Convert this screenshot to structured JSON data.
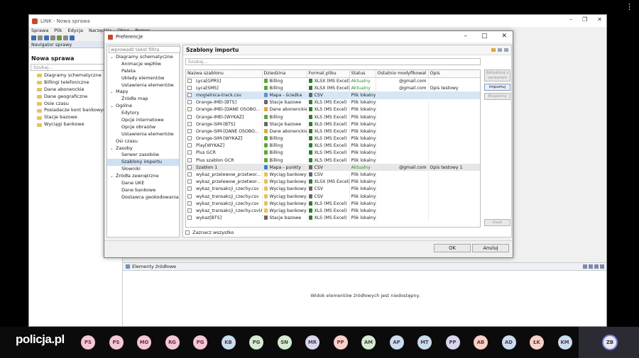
{
  "window": {
    "app_title": "LINK - Nowa sprawa",
    "menu": [
      "Sprawa",
      "Plik",
      "Edycja",
      "Narzędzia",
      "Okno",
      "Pomoc"
    ]
  },
  "navigator": {
    "tab": "Navigator sprawy",
    "title": "Nowa sprawa",
    "search_placeholder": "Szukaj...",
    "items": [
      "Diagramy schematyczne",
      "Billingi telefoniczne",
      "Dane abonenckie",
      "Dane geograficzne",
      "Osie czasu",
      "Posiadacze kont bankowych",
      "Stacje bazowe",
      "Wyciągi bankowe"
    ]
  },
  "bottom_panel": {
    "tab": "Elementy źródłowe",
    "message": "Widok elementów źródłowych jest niedostępny."
  },
  "dialog": {
    "title": "Preferencje",
    "filter_placeholder": "wprowadź tekst filtra",
    "tree": [
      {
        "label": "Diagramy schematyczne",
        "level": 0,
        "expander": "v"
      },
      {
        "label": "Animacje węzłów",
        "level": 1
      },
      {
        "label": "Paleta",
        "level": 1
      },
      {
        "label": "Układy elementów",
        "level": 1
      },
      {
        "label": "Ustawienia elementów",
        "level": 1
      },
      {
        "label": "Mapy",
        "level": 0,
        "expander": "v"
      },
      {
        "label": "Źródła map",
        "level": 1
      },
      {
        "label": "Ogólne",
        "level": 0,
        "expander": "v"
      },
      {
        "label": "Edytory",
        "level": 1
      },
      {
        "label": "Opcje internetowe",
        "level": 1
      },
      {
        "label": "Opcje obrazów",
        "level": 1
      },
      {
        "label": "Ustawienia elementów",
        "level": 1
      },
      {
        "label": "Osi czasu",
        "level": 0
      },
      {
        "label": "Zasoby",
        "level": 0,
        "expander": "v"
      },
      {
        "label": "Serwer zasobów",
        "level": 1
      },
      {
        "label": "Szablony importu",
        "level": 1,
        "selected": true
      },
      {
        "label": "Słowniki",
        "level": 1
      },
      {
        "label": "Źródła zewnętrzne",
        "level": 0,
        "expander": "v"
      },
      {
        "label": "Dane UKE",
        "level": 1
      },
      {
        "label": "Dane bankowe",
        "level": 1
      },
      {
        "label": "Dostawca geokodowania",
        "level": 1
      }
    ],
    "section_title": "Szablony importu",
    "search_placeholder": "Szukaj...",
    "columns": [
      "Nazwa szablonu",
      "Dziedzina",
      "Format pliku",
      "Status",
      "Ostatnio modyfikował",
      "Opis"
    ],
    "rows": [
      {
        "name": "Lyca[GPRS]",
        "domain": "Billing",
        "dom_color": "#5aa832",
        "format": "XLSX (MS Excel)",
        "fmt_color": "#2e7d32",
        "status": "Aktualny",
        "status_green": true,
        "modified": "@gmail.com",
        "desc": ""
      },
      {
        "name": "Lyca[SMS]",
        "domain": "Billing",
        "dom_color": "#5aa832",
        "format": "XLSX (MS Excel)",
        "fmt_color": "#2e7d32",
        "status": "Aktualny",
        "status_green": true,
        "modified": "@gmail.com",
        "desc": "Opis testowy"
      },
      {
        "name": "mogielnica-track.csv",
        "domain": "Mapa - ścieżka",
        "dom_color": "#5b8fd6",
        "format": "CSV",
        "fmt_color": "#666666",
        "status": "Plik lokalny",
        "status_green": false,
        "modified": "",
        "desc": "",
        "highlight": true
      },
      {
        "name": "Orange-IMEI-[BTS]",
        "domain": "Stacje bazowe",
        "dom_color": "#666666",
        "format": "XLS (MS Excel)",
        "fmt_color": "#2e7d32",
        "status": "Plik lokalny",
        "status_green": false,
        "modified": "",
        "desc": ""
      },
      {
        "name": "Orange-IMEI-[DANE OSOBO...",
        "domain": "Dane abonenckie",
        "dom_color": "#e0a63b",
        "format": "XLS (MS Excel)",
        "fmt_color": "#2e7d32",
        "status": "Plik lokalny",
        "status_green": false,
        "modified": "",
        "desc": ""
      },
      {
        "name": "Orange-IMEI-[WYKAZ]",
        "domain": "Billing",
        "dom_color": "#5aa832",
        "format": "XLS (MS Excel)",
        "fmt_color": "#2e7d32",
        "status": "Plik lokalny",
        "status_green": false,
        "modified": "",
        "desc": ""
      },
      {
        "name": "Orange-SIM-[BTS]",
        "domain": "Stacje bazowe",
        "dom_color": "#666666",
        "format": "XLS (MS Excel)",
        "fmt_color": "#2e7d32",
        "status": "Plik lokalny",
        "status_green": false,
        "modified": "",
        "desc": ""
      },
      {
        "name": "Orange-SIM-[DANE OSOBO...",
        "domain": "Dane abonenckie",
        "dom_color": "#e0a63b",
        "format": "XLS (MS Excel)",
        "fmt_color": "#2e7d32",
        "status": "Plik lokalny",
        "status_green": false,
        "modified": "",
        "desc": ""
      },
      {
        "name": "Orange-SIM-[WYKAZ]",
        "domain": "Billing",
        "dom_color": "#5aa832",
        "format": "XLS (MS Excel)",
        "fmt_color": "#2e7d32",
        "status": "Plik lokalny",
        "status_green": false,
        "modified": "",
        "desc": ""
      },
      {
        "name": "Play[WYKAZ]",
        "domain": "Billing",
        "dom_color": "#5aa832",
        "format": "XLS (MS Excel)",
        "fmt_color": "#2e7d32",
        "status": "Plik lokalny",
        "status_green": false,
        "modified": "",
        "desc": ""
      },
      {
        "name": "Plus GCR",
        "domain": "Billing",
        "dom_color": "#5aa832",
        "format": "XLS (MS Excel)",
        "fmt_color": "#2e7d32",
        "status": "Plik lokalny",
        "status_green": false,
        "modified": "",
        "desc": ""
      },
      {
        "name": "Plus szablon GCR",
        "domain": "Billing",
        "dom_color": "#5aa832",
        "format": "XLS (MS Excel)",
        "fmt_color": "#2e7d32",
        "status": "Plik lokalny",
        "status_green": false,
        "modified": "",
        "desc": ""
      },
      {
        "name": "Szablon 1",
        "domain": "Mapa - punkty",
        "dom_color": "#3a7bd5",
        "format": "CSV",
        "fmt_color": "#666666",
        "status": "Aktualny",
        "status_green": true,
        "modified": "@gmail.com",
        "desc": "Opis testowy 1",
        "gray": true
      },
      {
        "name": "wykaz_przelewow_przetwor...",
        "domain": "Wyciąg bankowy",
        "dom_color": "#e7c15d",
        "format": "CSV",
        "fmt_color": "#666666",
        "status": "Plik lokalny",
        "status_green": false,
        "modified": "",
        "desc": ""
      },
      {
        "name": "wykaz_przelewow_przetwor...",
        "domain": "Wyciąg bankowy",
        "dom_color": "#e7c15d",
        "format": "XLSX (MS Excel)",
        "fmt_color": "#2e7d32",
        "status": "Plik lokalny",
        "status_green": false,
        "modified": "",
        "desc": ""
      },
      {
        "name": "wykaz_transakcji_czechy.csv",
        "domain": "Wyciąg bankowy",
        "dom_color": "#e7c15d",
        "format": "CSV",
        "fmt_color": "#666666",
        "status": "Plik lokalny",
        "status_green": false,
        "modified": "",
        "desc": ""
      },
      {
        "name": "wykaz_transakcji_czechy.csv",
        "domain": "Wyciąg bankowy",
        "dom_color": "#e7c15d",
        "format": "CSV",
        "fmt_color": "#666666",
        "status": "Plik lokalny",
        "status_green": false,
        "modified": "",
        "desc": ""
      },
      {
        "name": "wykaz_transakcji_czechy.csv",
        "domain": "Wyciąg bankowy",
        "dom_color": "#e7c15d",
        "format": "XLS (MS Excel)",
        "fmt_color": "#2e7d32",
        "status": "Plik lokalny",
        "status_green": false,
        "modified": "",
        "desc": ""
      },
      {
        "name": "wykaz_transakcji_czechy.csv(A...",
        "domain": "Wyciąg bankowy",
        "dom_color": "#e7c15d",
        "format": "XLS (MS Excel)",
        "fmt_color": "#2e7d32",
        "status": "Plik lokalny",
        "status_green": false,
        "modified": "",
        "desc": ""
      },
      {
        "name": "wykaz[BTS]",
        "domain": "Stacje bazowe",
        "dom_color": "#666666",
        "format": "XLS (MS Excel)",
        "fmt_color": "#2e7d32",
        "status": "Plik lokalny",
        "status_green": false,
        "modified": "",
        "desc": ""
      }
    ],
    "buttons": {
      "update": "Aktualizuj z serwerem",
      "import": "Importuj",
      "export": "Eksportuj",
      "delete": "Usuń",
      "select_all": "Zaznacz wszystko",
      "ok": "OK",
      "cancel": "Anuluj"
    }
  },
  "call": {
    "brand": "policja.pl",
    "participants": [
      {
        "initials": "PS",
        "color": "#f6c6d6"
      },
      {
        "initials": "PS",
        "color": "#f6c6d6"
      },
      {
        "initials": "MO",
        "color": "#f6c6d6"
      },
      {
        "initials": "RG",
        "color": "#f6c6d6"
      },
      {
        "initials": "PG",
        "color": "#f6c6d6"
      },
      {
        "initials": "KB",
        "color": "#c9dcf0"
      },
      {
        "initials": "PG",
        "color": "#d2ecd0"
      },
      {
        "initials": "SN",
        "color": "#d2ecd0"
      },
      {
        "initials": "MR",
        "color": "#d6d6f2"
      },
      {
        "initials": "PP",
        "color": "#f8d0c8"
      },
      {
        "initials": "AM",
        "color": "#d2ecd0"
      },
      {
        "initials": "AP",
        "color": "#c9dcf0"
      },
      {
        "initials": "MT",
        "color": "#c9dcf0"
      },
      {
        "initials": "PP",
        "color": "#d6d6f2"
      },
      {
        "initials": "AB",
        "color": "#f8d0c8"
      },
      {
        "initials": "AD",
        "color": "#c9dcf0"
      },
      {
        "initials": "ŁK",
        "color": "#f8d0c8"
      },
      {
        "initials": "KM",
        "color": "#c9dcf0"
      }
    ],
    "self": "ZB"
  }
}
